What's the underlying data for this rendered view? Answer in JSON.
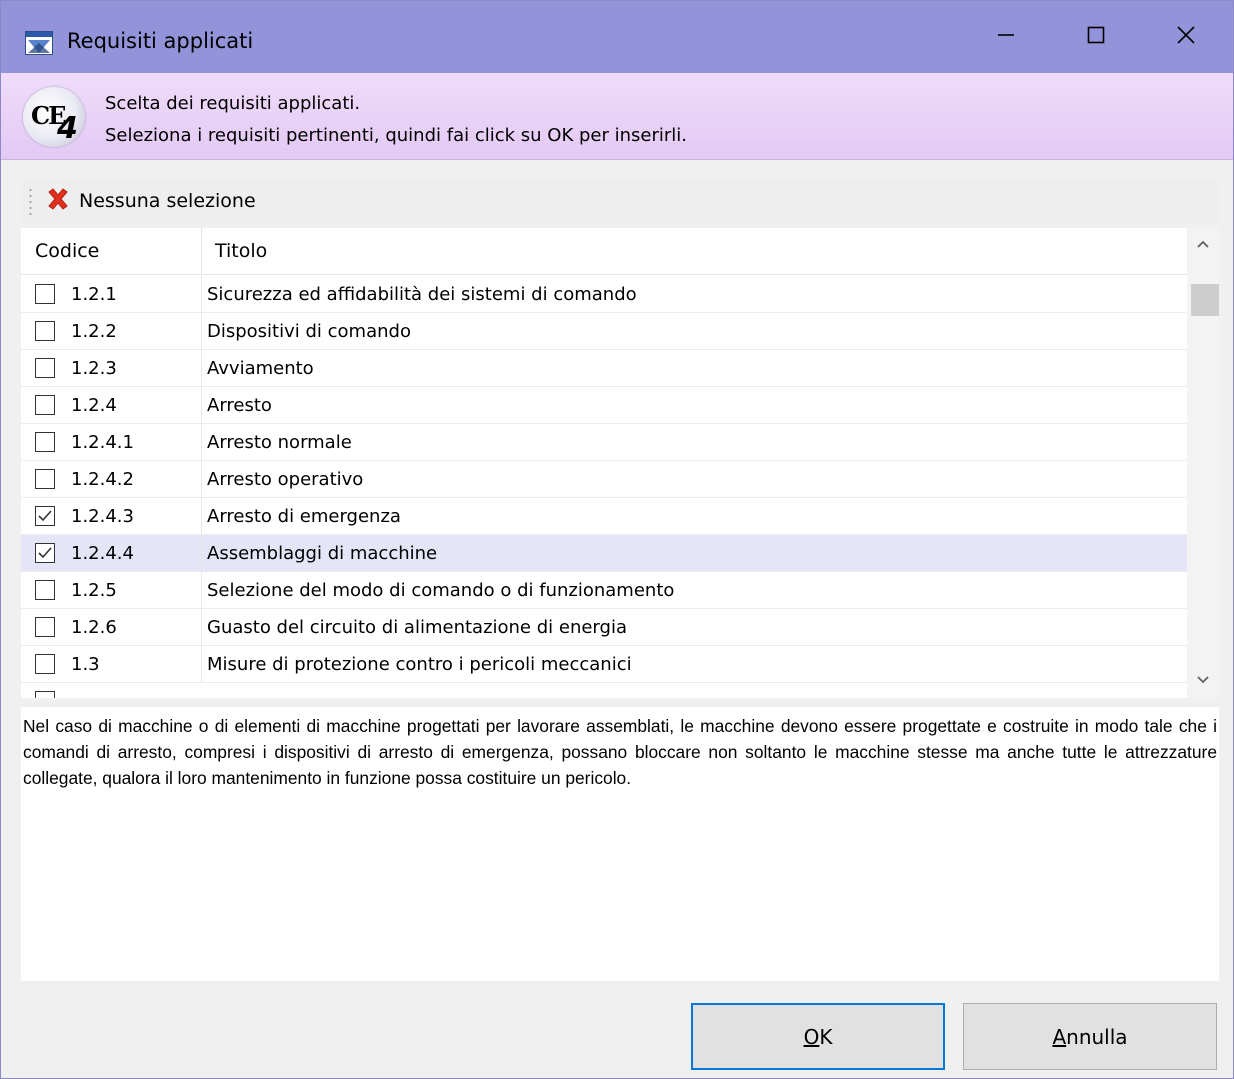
{
  "window": {
    "title": "Requisiti applicati",
    "icon": "app-window-icon",
    "minimize_icon": "minimize-icon",
    "maximize_icon": "maximize-icon",
    "close_icon": "close-icon"
  },
  "banner": {
    "logo_text": "CE",
    "logo_sub": "4",
    "line1": "Scelta dei requisiti applicati.",
    "line2": "Seleziona i requisiti pertinenti, quindi fai click su OK per inserirli."
  },
  "toolbar": {
    "clear_label": "Nessuna selezione",
    "clear_icon": "red-x-icon",
    "clear_icon_color": "#e0301e"
  },
  "list": {
    "columns": {
      "code": "Codice",
      "title": "Titolo"
    },
    "rows": [
      {
        "code": "1.2.1",
        "title": "Sicurezza ed affidabilità dei sistemi di comando",
        "checked": false,
        "selected": false
      },
      {
        "code": "1.2.2",
        "title": "Dispositivi di comando",
        "checked": false,
        "selected": false
      },
      {
        "code": "1.2.3",
        "title": "Avviamento",
        "checked": false,
        "selected": false
      },
      {
        "code": "1.2.4",
        "title": "Arresto",
        "checked": false,
        "selected": false
      },
      {
        "code": "1.2.4.1",
        "title": "Arresto normale",
        "checked": false,
        "selected": false
      },
      {
        "code": "1.2.4.2",
        "title": "Arresto operativo",
        "checked": false,
        "selected": false
      },
      {
        "code": "1.2.4.3",
        "title": "Arresto di emergenza",
        "checked": true,
        "selected": false
      },
      {
        "code": "1.2.4.4",
        "title": "Assemblaggi di macchine",
        "checked": true,
        "selected": true
      },
      {
        "code": "1.2.5",
        "title": "Selezione del modo di comando o di funzionamento",
        "checked": false,
        "selected": false
      },
      {
        "code": "1.2.6",
        "title": "Guasto del circuito di alimentazione di energia",
        "checked": false,
        "selected": false
      },
      {
        "code": "1.3",
        "title": "Misure di protezione contro i pericoli meccanici",
        "checked": false,
        "selected": false
      }
    ],
    "selection_color": "#e5e5f8"
  },
  "description": {
    "text": "Nel caso di macchine o di elementi di macchine progettati per lavorare assemblati, le macchine devono essere progettate e costruite in modo tale che i comandi di arresto, compresi i dispositivi di arresto di emergenza, possano bloccare non soltanto le macchine stesse ma anche tutte le attrezzature collegate, qualora il loro mantenimento in funzione possa costituire un pericolo."
  },
  "buttons": {
    "ok_mnemonic": "O",
    "ok_rest": "K",
    "cancel_mnemonic": "A",
    "cancel_rest": "nnulla",
    "ok_border_color": "#0078d7"
  }
}
